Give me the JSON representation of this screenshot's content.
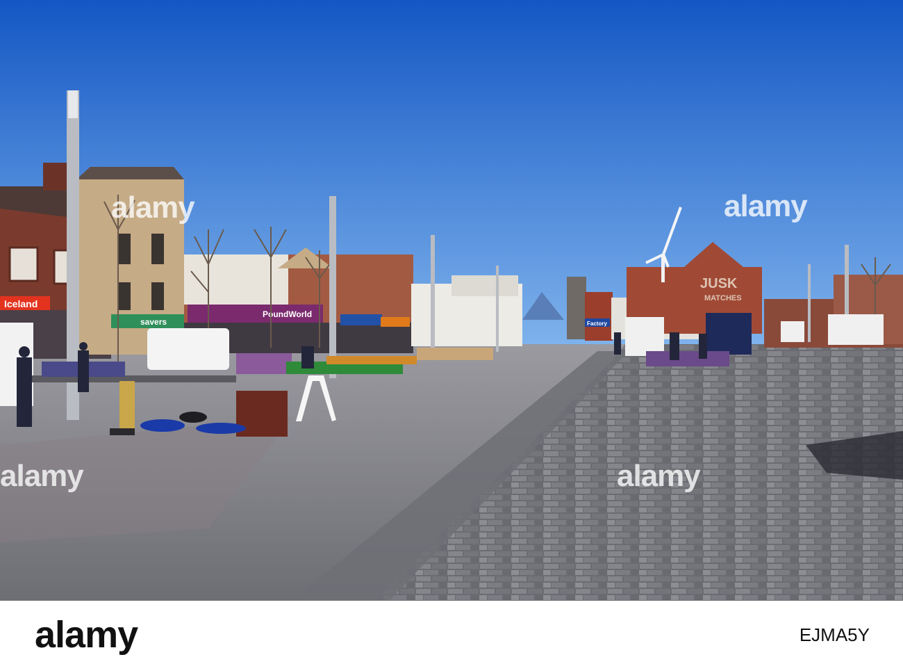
{
  "scene": {
    "signs": {
      "iceland": "Iceland",
      "savers": "savers",
      "poundworld": "PoundWorld",
      "factory": "Factory",
      "jusk": "JUSK",
      "matches": "MATCHES"
    }
  },
  "watermarks": [
    "alamy",
    "alamy",
    "alamy",
    "alamy"
  ],
  "footer": {
    "logo": "alamy",
    "image_id": "EJMA5Y"
  },
  "colors": {
    "sky_top": "#1a63c9",
    "sky_bottom": "#6aa8e8",
    "pavement": "#8a8a8e",
    "pavement_dark": "#5f6066"
  }
}
